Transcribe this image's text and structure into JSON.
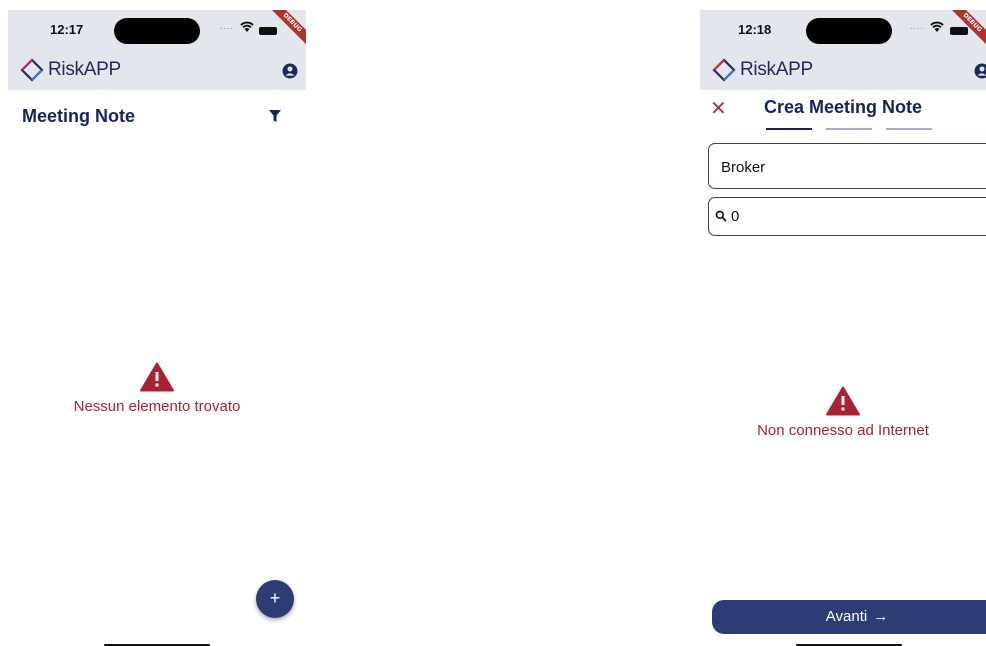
{
  "left_screen": {
    "status": {
      "time": "12:17",
      "signal_dots": "....",
      "debug_label": "DEBUG"
    },
    "app": {
      "name": "RiskAPP"
    },
    "page_title": "Meeting Note",
    "empty_state": {
      "message": "Nessun elemento trovato"
    },
    "fab_label": "+"
  },
  "right_screen": {
    "status": {
      "time": "12:18",
      "signal_dots": "....",
      "debug_label": "DEBUG"
    },
    "app": {
      "name": "RiskAPP"
    },
    "close_label": "✕",
    "page_title": "Crea Meeting Note",
    "steps": {
      "total": 3,
      "current": 1
    },
    "broker_field": {
      "value": "Broker"
    },
    "search_field": {
      "value": "0"
    },
    "error_state": {
      "message": "Non connesso ad Internet"
    },
    "next_button": {
      "label": "Avanti",
      "arrow": "→"
    }
  },
  "colors": {
    "primary": "#2e3b75",
    "title": "#17245a",
    "error": "#a82234",
    "appbar_bg": "#e4e6ee"
  }
}
